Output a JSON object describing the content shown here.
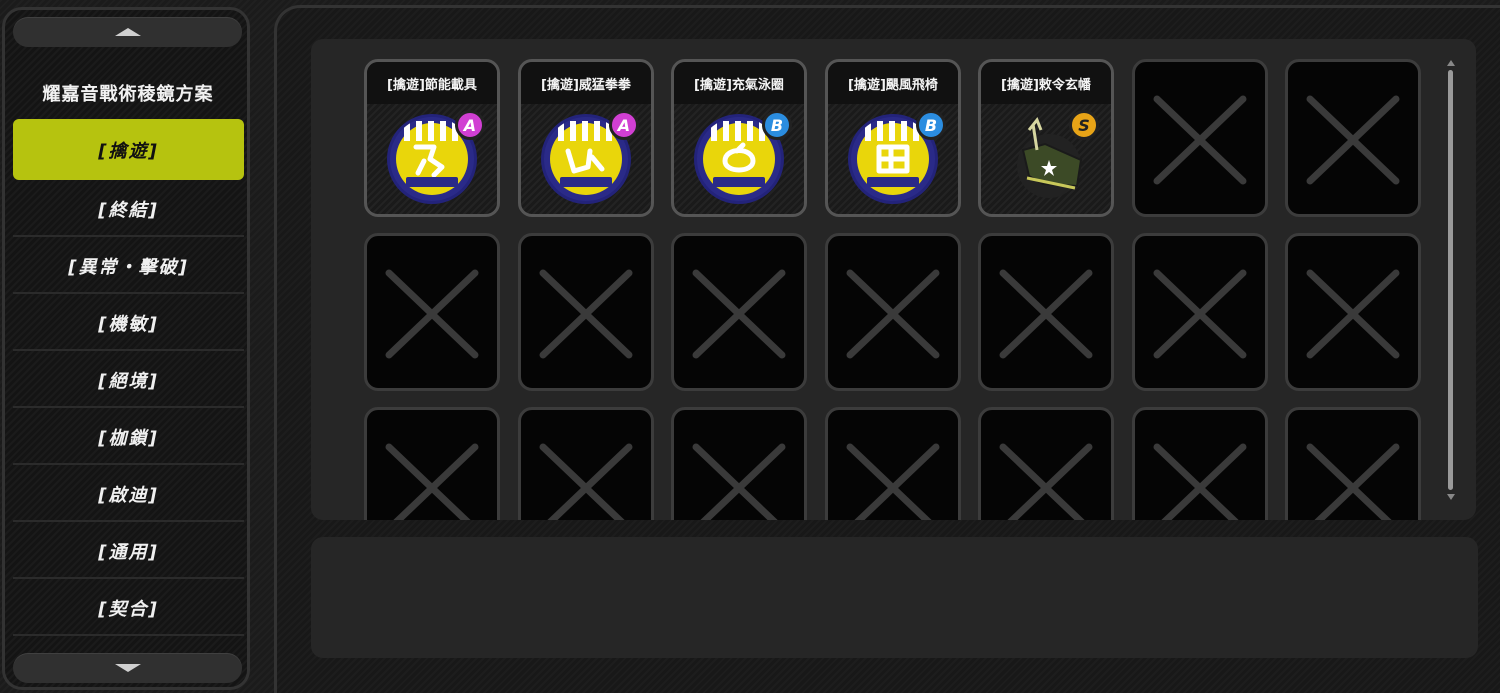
{
  "sidebar": {
    "title": "耀嘉音戰術稜鏡方案",
    "items": [
      {
        "label": "[擒遊]",
        "active": true
      },
      {
        "label": "[終結]",
        "active": false
      },
      {
        "label": "[異常・擊破]",
        "active": false
      },
      {
        "label": "[機敏]",
        "active": false
      },
      {
        "label": "[絕境]",
        "active": false
      },
      {
        "label": "[枷鎖]",
        "active": false
      },
      {
        "label": "[啟迪]",
        "active": false
      },
      {
        "label": "[通用]",
        "active": false
      },
      {
        "label": "[契合]",
        "active": false
      }
    ]
  },
  "grid": {
    "columns": 7,
    "rows": 3,
    "items": [
      {
        "name": "[擒遊]節能載具",
        "rank": "A",
        "icon": "cyclist-medal-icon"
      },
      {
        "name": "[擒遊]威猛拳拳",
        "rank": "A",
        "icon": "punch-medal-icon"
      },
      {
        "name": "[擒遊]充氣泳圈",
        "rank": "B",
        "icon": "swim-ring-medal-icon"
      },
      {
        "name": "[擒遊]颶風飛椅",
        "rank": "B",
        "icon": "fist-medal-icon"
      },
      {
        "name": "[擒遊]敕令玄幡",
        "rank": "S",
        "icon": "banner-hat-icon"
      }
    ],
    "empty_count": 16
  },
  "description": {
    "text": ""
  },
  "colors": {
    "accent": "#b6c30f",
    "rank_A": "#d13fd3",
    "rank_B": "#2b8de0",
    "rank_S": "#e8a417"
  }
}
